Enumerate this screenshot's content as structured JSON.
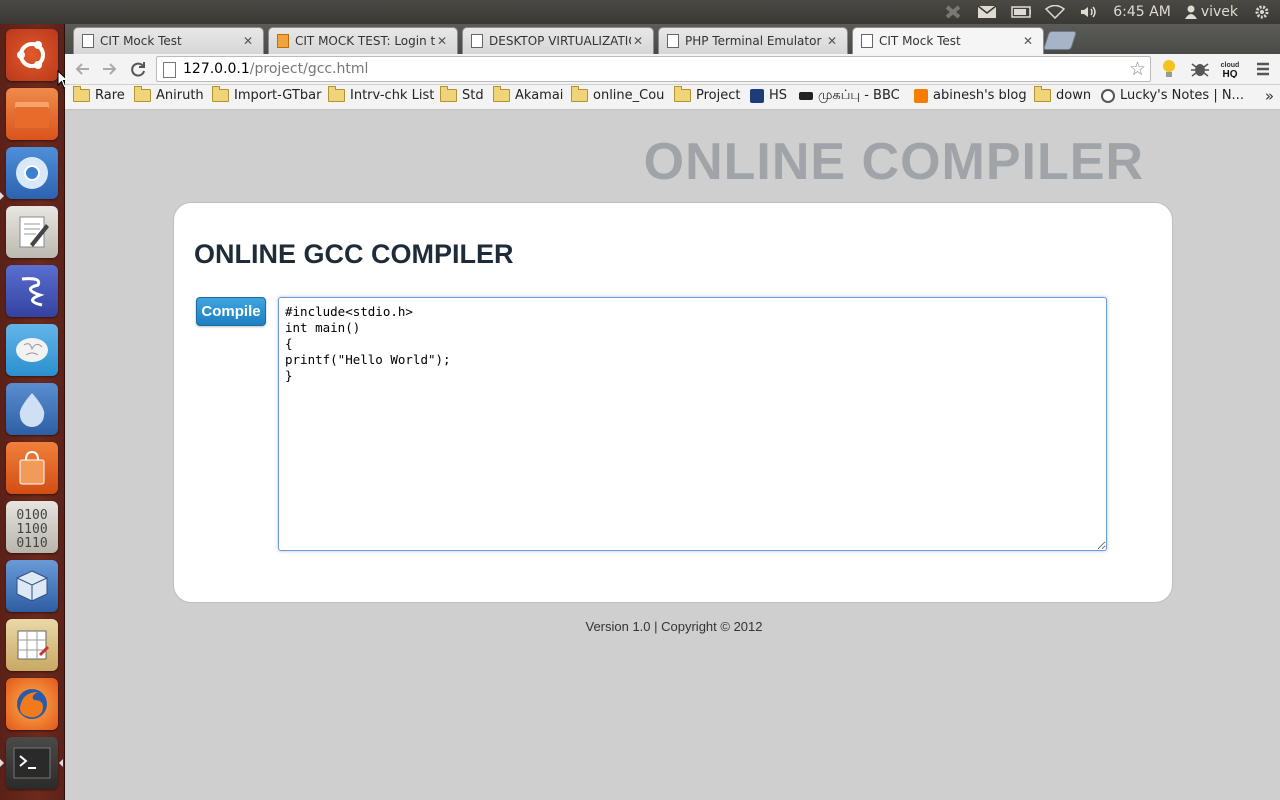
{
  "system_panel": {
    "clock": "6:45 AM",
    "user": "vivek"
  },
  "browser": {
    "tabs": [
      {
        "title": "CIT Mock Test",
        "active": false
      },
      {
        "title": "CIT MOCK TEST: Login to t",
        "active": false
      },
      {
        "title": "DESKTOP VIRTUALIZATIO",
        "active": false
      },
      {
        "title": "PHP Terminal Emulator",
        "active": false
      },
      {
        "title": "CIT Mock Test",
        "active": true
      }
    ],
    "url_host": "127.0.0.1",
    "url_path": "/project/gcc.html",
    "bookmarks": [
      {
        "label": "Rare",
        "type": "folder"
      },
      {
        "label": "Aniruth",
        "type": "folder"
      },
      {
        "label": "Import-GTbar",
        "type": "folder"
      },
      {
        "label": "Intrv-chk List",
        "type": "folder"
      },
      {
        "label": "Std",
        "type": "folder"
      },
      {
        "label": "Akamai",
        "type": "folder"
      },
      {
        "label": "online_Cou",
        "type": "folder"
      },
      {
        "label": "Project",
        "type": "folder"
      },
      {
        "label": "HS",
        "type": "link"
      },
      {
        "label": "முகப்பு - BBC",
        "type": "link"
      },
      {
        "label": "abinesh's blog",
        "type": "link"
      },
      {
        "label": "down",
        "type": "folder"
      },
      {
        "label": "Lucky's Notes | N...",
        "type": "link"
      }
    ],
    "bookmarks_more": "»"
  },
  "page": {
    "site_title": "ONLINE COMPILER",
    "heading": "ONLINE GCC COMPILER",
    "compile_label": "Compile",
    "code": "#include<stdio.h>\nint main()\n{\nprintf(\"Hello World\");\n}",
    "footer": "Version 1.0 | Copyright © 2012"
  },
  "colors": {
    "compile_button": "#2a8fd2",
    "launcher": "#6e2a1d",
    "page_background": "#cfcfcf"
  }
}
